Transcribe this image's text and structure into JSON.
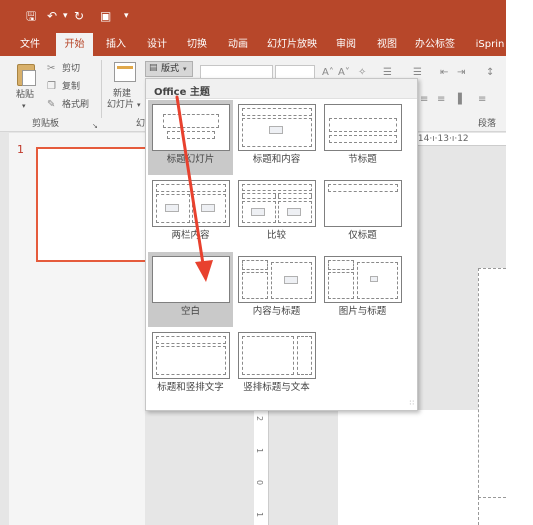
{
  "qat": {
    "save_icon": "save-icon",
    "undo_icon": "undo-icon",
    "redo_icon": "redo-icon",
    "slideshow_icon": "present-from-start-icon",
    "customize": "▾"
  },
  "tabs": [
    "文件",
    "开始",
    "插入",
    "设计",
    "切换",
    "动画",
    "幻灯片放映",
    "审阅",
    "视图",
    "办公标签",
    "iSprin"
  ],
  "active_tab": "开始",
  "ribbon": {
    "paste_label": "粘贴",
    "cut_label": "剪切",
    "copy_label": "复制",
    "format_painter_label": "格式刷",
    "clipboard_group": "剪贴板",
    "new_slide_label": "新建",
    "new_slide_sub": "幻灯片",
    "layout_label": "版式",
    "slides_group_fragment": "幻",
    "paragraph_group": "段落"
  },
  "ruler_top": "·14·ı·13·ı·12",
  "ruler_left_ticks": [
    "2",
    "1",
    "0",
    "1"
  ],
  "slide_number": "1",
  "layout_menu": {
    "header": "Office 主题",
    "items": [
      {
        "name": "标题幻灯片",
        "layout": "title-slide",
        "state": "selected"
      },
      {
        "name": "标题和内容",
        "layout": "title-content",
        "state": "normal"
      },
      {
        "name": "节标题",
        "layout": "section-header",
        "state": "normal"
      },
      {
        "name": "两栏内容",
        "layout": "two-content",
        "state": "normal"
      },
      {
        "name": "比较",
        "layout": "comparison",
        "state": "normal"
      },
      {
        "name": "仅标题",
        "layout": "title-only",
        "state": "normal"
      },
      {
        "name": "空白",
        "layout": "blank",
        "state": "hover"
      },
      {
        "name": "内容与标题",
        "layout": "content-caption",
        "state": "normal"
      },
      {
        "name": "图片与标题",
        "layout": "picture-caption",
        "state": "normal"
      },
      {
        "name": "标题和竖排文字",
        "layout": "title-vertical-text",
        "state": "normal"
      },
      {
        "name": "竖排标题与文本",
        "layout": "vertical-title-text",
        "state": "normal"
      }
    ]
  },
  "colors": {
    "accent": "#b7472a",
    "arrow": "#e8412e",
    "selected_bg": "#c9c9c9"
  }
}
